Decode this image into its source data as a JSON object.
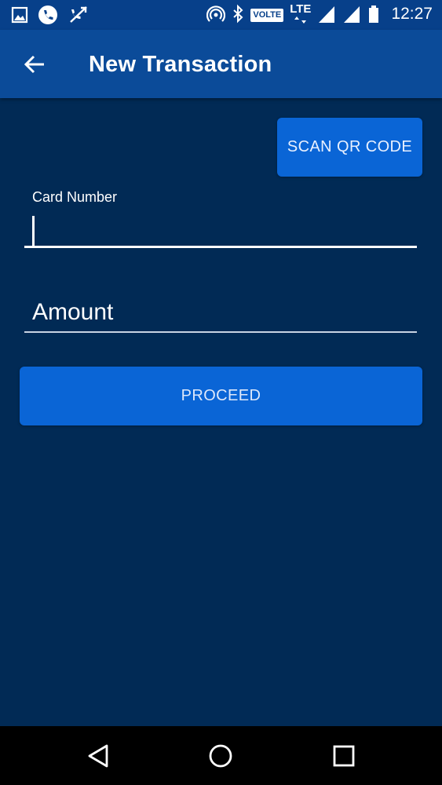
{
  "status_bar": {
    "volte": "VOLTE",
    "network": "LTE",
    "time": "12:27",
    "icons": [
      "image-icon",
      "phone-call-icon",
      "missed-call-icon",
      "hotspot-icon",
      "bluetooth-icon",
      "signal-icon",
      "signal-icon",
      "battery-icon"
    ]
  },
  "app_bar": {
    "title": "New Transaction",
    "back_icon": "arrow-back-icon"
  },
  "form": {
    "scan_button_label": "SCAN QR CODE",
    "card_number_label": "Card Number",
    "card_number_value": "",
    "amount_placeholder": "Amount",
    "amount_value": "",
    "proceed_button_label": "PROCEED"
  },
  "nav_bar": {
    "icons": [
      "back-triangle-icon",
      "home-circle-icon",
      "recents-square-icon"
    ]
  },
  "colors": {
    "background": "#012a55",
    "app_bar": "#0b4b99",
    "status_bar": "#07408a",
    "button": "#0a65d6"
  }
}
